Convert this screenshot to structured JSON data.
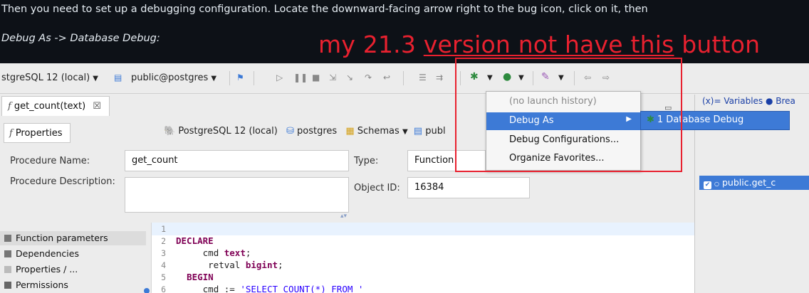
{
  "doc": {
    "line1": "Then you need to set up a debugging configuration. Locate the downward-facing arrow right to the bug icon, click on it, then",
    "line2": "Debug As -> Database Debug:"
  },
  "annotation": {
    "prefix": "my 21.3 ",
    "underlined": "version not have this",
    "suffix": " button",
    "color": "#e8212f"
  },
  "toolbar": {
    "connection": "stgreSQL 12 (local)",
    "schema": "public@postgres"
  },
  "editor": {
    "tab_label": "get_count(text)",
    "tab_close": "☒",
    "properties_tab": "Properties",
    "breadcrumbs": {
      "connection": "PostgreSQL 12 (local)",
      "database": "postgres",
      "schemas": "Schemas",
      "schema": "publ"
    }
  },
  "form": {
    "procedure_name_label": "Procedure Name:",
    "procedure_name_value": "get_count",
    "procedure_desc_label": "Procedure Description:",
    "type_label": "Type:",
    "type_value": "Function",
    "object_id_label": "Object ID:",
    "object_id_value": "16384"
  },
  "outline": {
    "items": [
      "Function parameters",
      "Dependencies",
      "Properties / ...",
      "Permissions"
    ]
  },
  "code": {
    "line_numbers": [
      "1",
      "2",
      "3",
      "4",
      "5",
      "6"
    ],
    "line2_kw": "DECLARE",
    "line3_name": "cmd ",
    "line3_type": "text",
    "line3_end": ";",
    "line4_name": "retval ",
    "line4_type": "bigint",
    "line4_end": ";",
    "line5_kw": "BEGIN",
    "line6_name": "cmd := ",
    "line6_str": "'SELECT COUNT(*) FROM '"
  },
  "right_panel": {
    "tabs": "(x)= Variables  ● Brea",
    "breakpoint": "public.get_c"
  },
  "menu": {
    "items": [
      "(no launch history)",
      "Debug As",
      "Debug Configurations...",
      "Organize Favorites..."
    ],
    "submenu_item": "1 Database Debug"
  },
  "colors": {
    "accent": "#3d7ad6",
    "annotation": "#e8212f"
  }
}
